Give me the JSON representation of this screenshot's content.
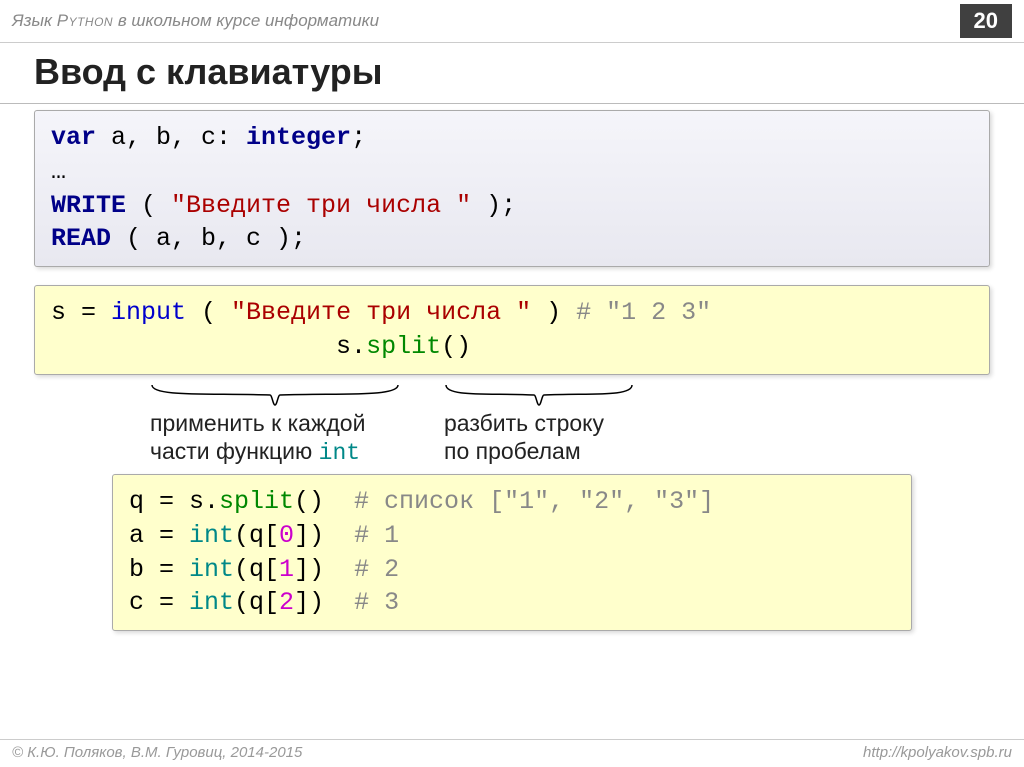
{
  "header": {
    "subtitle_prefix": "Язык ",
    "subtitle_lang": "Python",
    "subtitle_suffix": " в школьном курсе информатики",
    "page_number": "20"
  },
  "title": "Ввод с клавиатуры",
  "pascal": {
    "kw_var": "var",
    "decl_body": " a, b, c: ",
    "kw_integer": "integer",
    "semicolon": ";",
    "ellipsis": "…",
    "write": "WRITE",
    "write_open": " ( ",
    "write_str": "\"Введите три числа \"",
    "write_close": " );",
    "read": "READ",
    "read_args": " ( a, b, c );"
  },
  "python1": {
    "lhs": "s = ",
    "input": "input",
    "paren_open": " ( ",
    "prompt": "\"Введите три числа \"",
    "paren_close": " ) ",
    "comment": "# \"1 2 3\"",
    "indent2": "                   s.",
    "split": "split",
    "split_parens": "()"
  },
  "annotations": {
    "left_line1": "применить к каждой",
    "left_line2_a": "части функцию ",
    "left_line2_b": "int",
    "right_line1": "разбить строку",
    "right_line2": "по пробелам"
  },
  "python2": {
    "l1a": "q = s.",
    "l1_split": "split",
    "l1b": "()  ",
    "l1_comment": "# список [\"1\", \"2\", \"3\"]",
    "l2a": "a = ",
    "l2_int": "int",
    "l2b": "(q[",
    "l2_idx": "0",
    "l2c": "])  ",
    "l2_comment": "# 1",
    "l3a": "b = ",
    "l3_int": "int",
    "l3b": "(q[",
    "l3_idx": "1",
    "l3c": "])  ",
    "l3_comment": "# 2",
    "l4a": "c = ",
    "l4_int": "int",
    "l4b": "(q[",
    "l4_idx": "2",
    "l4c": "])  ",
    "l4_comment": "# 3"
  },
  "footer": {
    "left": "© К.Ю. Поляков, В.М. Гуровиц, 2014-2015",
    "right": "http://kpolyakov.spb.ru"
  }
}
